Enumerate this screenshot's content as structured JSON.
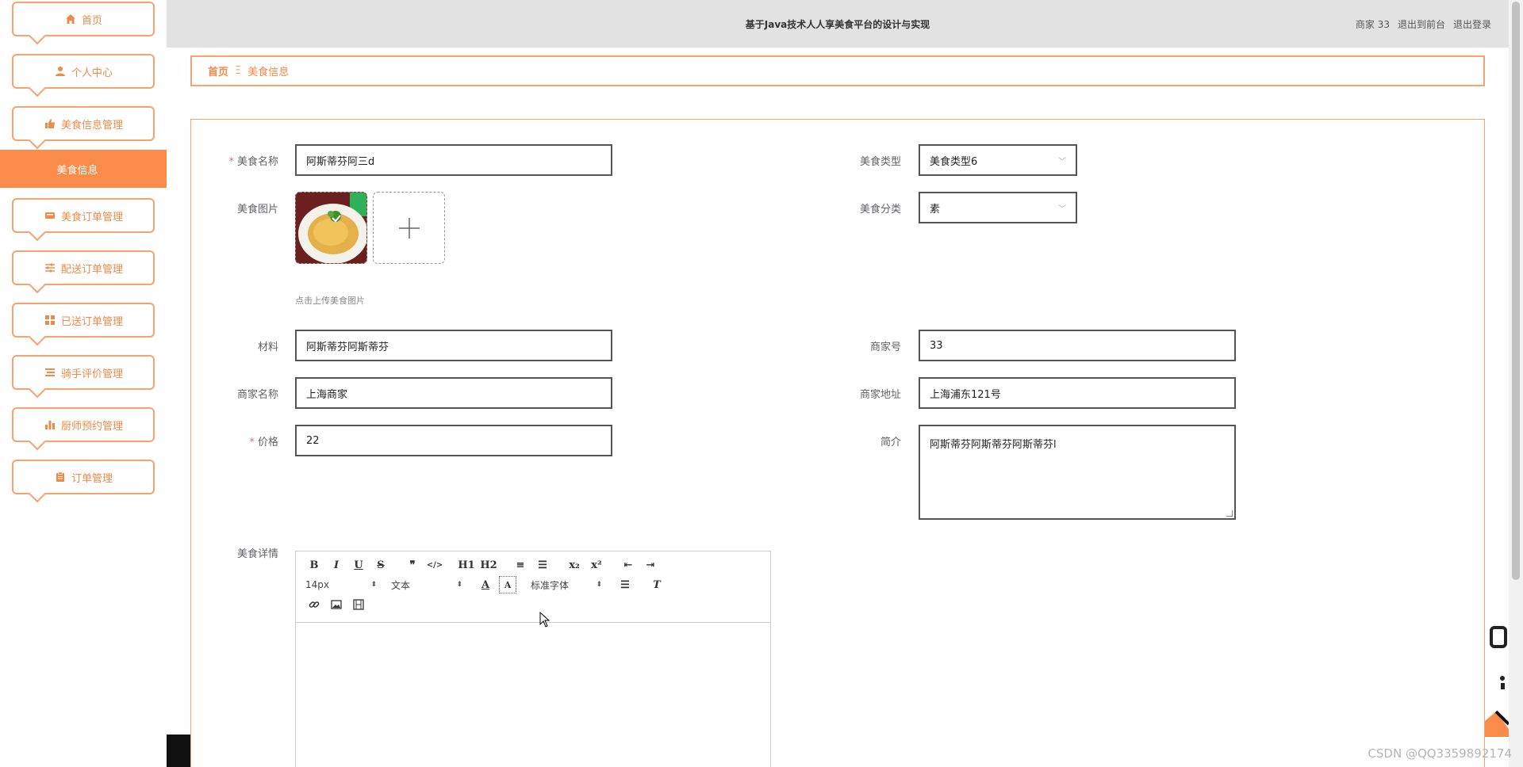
{
  "header": {
    "title": "基于Java技术人人享美食平台的设计与实现",
    "user": "商家 33",
    "go_front": "退出到前台",
    "logout": "退出登录"
  },
  "sidebar": {
    "items": [
      {
        "label": "首页",
        "icon": "home-icon"
      },
      {
        "label": "个人中心",
        "icon": "user-icon"
      },
      {
        "label": "美食信息管理",
        "icon": "thumbs-up-icon"
      },
      {
        "label": "美食订单管理",
        "icon": "ticket-icon"
      },
      {
        "label": "配送订单管理",
        "icon": "sliders-icon"
      },
      {
        "label": "已送订单管理",
        "icon": "grid-icon"
      },
      {
        "label": "骑手评价管理",
        "icon": "list-icon"
      },
      {
        "label": "厨师预约管理",
        "icon": "bar-chart-icon"
      },
      {
        "label": "订单管理",
        "icon": "clipboard-icon"
      }
    ],
    "active_sub": "美食信息"
  },
  "breadcrumb": {
    "home": "首页",
    "separator": "Ξ",
    "current": "美食信息"
  },
  "form": {
    "name_label": "美食名称",
    "name_value": "阿斯蒂芬阿三d",
    "type_label": "美食类型",
    "type_value": "美食类型6",
    "image_label": "美食图片",
    "image_hint": "点击上传美食图片",
    "category_label": "美食分类",
    "category_value": "素",
    "material_label": "材料",
    "material_value": "阿斯蒂芬阿斯蒂芬",
    "merchant_no_label": "商家号",
    "merchant_no_value": "33",
    "merchant_name_label": "商家名称",
    "merchant_name_value": "上海商家",
    "merchant_addr_label": "商家地址",
    "merchant_addr_value": "上海浦东121号",
    "price_label": "价格",
    "price_value": "22",
    "intro_label": "简介",
    "intro_value": "阿斯蒂芬阿斯蒂芬阿斯蒂芬l",
    "detail_label": "美食详情",
    "required_mark": "*"
  },
  "editor": {
    "font_size": "14px",
    "header_picker": "文本",
    "font_family": "标准字体",
    "buttons_row1": [
      "B",
      "I",
      "U",
      "S",
      "❞",
      "</>",
      "H1",
      "H2",
      "≡",
      "☰",
      "x₂",
      "x²",
      "⇤",
      "⇥"
    ]
  },
  "watermark": "CSDN @QQ3359892174",
  "colors": {
    "accent": "#f98c4b",
    "border_accent": "#f5a36f",
    "header_bg": "#e2e2e2"
  }
}
